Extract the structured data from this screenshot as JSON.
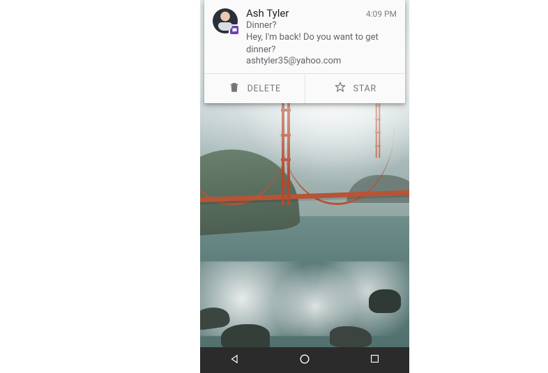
{
  "notification": {
    "sender": "Ash Tyler",
    "time": "4:09 PM",
    "subject": "Dinner?",
    "preview": "Hey, I'm back!  Do you want to get dinner?",
    "address": "ashtyler35@yahoo.com",
    "app_badge": "yahoo-mail",
    "actions": {
      "delete": "DELETE",
      "star": "STAR"
    }
  }
}
